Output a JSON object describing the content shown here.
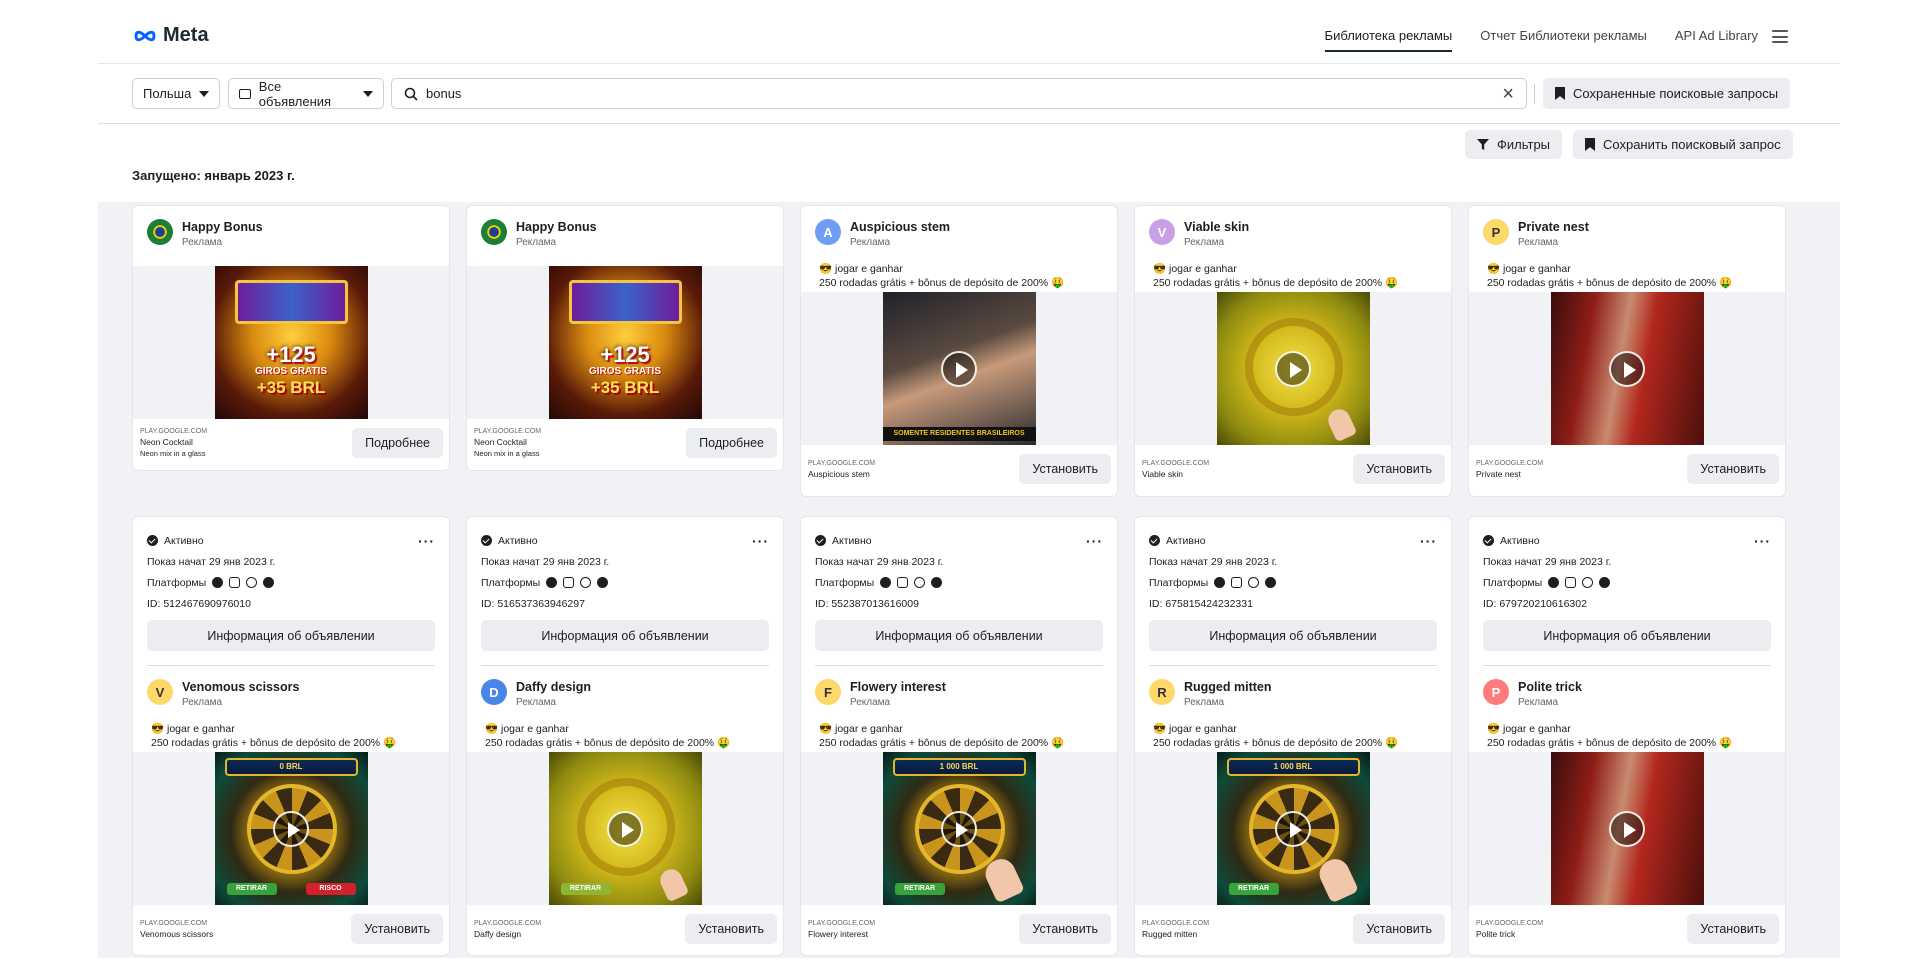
{
  "header": {
    "logo_text": "Meta",
    "nav": [
      "Библиотека рекламы",
      "Отчет Библиотеки рекламы",
      "API Ad Library"
    ]
  },
  "search": {
    "country": "Польша",
    "category": "Все объявления",
    "query": "bonus",
    "saved_searches_label": "Сохраненные поисковые запросы"
  },
  "toolbar": {
    "filters_label": "Фильтры",
    "save_search_label": "Сохранить поисковый запрос"
  },
  "launched_label": "Запущено: январь 2023 г.",
  "top_cards": [
    {
      "name": "Happy Bonus",
      "sub": "Реклама",
      "avatar_letter": "",
      "text1": "",
      "text2": "",
      "domain": "PLAY.GOOGLE.COM",
      "footer_name": "Neon Cocktail",
      "footer_desc": "Neon mix in a glass",
      "cta": "Подробнее",
      "creative": {
        "top": "",
        "big": "+125",
        "small": "GIROS GRATIS",
        "cash": "+35 BRL"
      }
    },
    {
      "name": "Happy Bonus",
      "sub": "Реклама",
      "avatar_letter": "",
      "text1": "",
      "text2": "",
      "domain": "PLAY.GOOGLE.COM",
      "footer_name": "Neon Cocktail",
      "footer_desc": "Neon mix in a glass",
      "cta": "Подробнее",
      "creative": {
        "top": "",
        "big": "+125",
        "small": "GIROS GRATIS",
        "cash": "+35 BRL"
      }
    },
    {
      "name": "Auspicious stem",
      "sub": "Реклама",
      "avatar_letter": "A",
      "text1": "😎 jogar e ganhar",
      "text2": "250 rodadas grátis + bônus de depósito de 200% 🤑",
      "domain": "PLAY.GOOGLE.COM",
      "footer_name": "Auspicious stem",
      "footer_desc": "",
      "cta": "Установить",
      "creative": {
        "top": "",
        "big": "",
        "small": "",
        "cash": "SOMENTE RESIDENTES BRASILEIROS"
      }
    },
    {
      "name": "Viable skin",
      "sub": "Реклама",
      "avatar_letter": "V",
      "text1": "😎 jogar e ganhar",
      "text2": "250 rodadas grátis + bônus de depósito de 200% 🤑",
      "domain": "PLAY.GOOGLE.COM",
      "footer_name": "Viable skin",
      "footer_desc": "",
      "cta": "Установить",
      "creative": {
        "top": "",
        "big": "",
        "small": "",
        "cash": ""
      }
    },
    {
      "name": "Private nest",
      "sub": "Реклама",
      "avatar_letter": "P",
      "text1": "😎 jogar e ganhar",
      "text2": "250 rodadas grátis + bônus de depósito de 200% 🤑",
      "domain": "PLAY.GOOGLE.COM",
      "footer_name": "Private nest",
      "footer_desc": "",
      "cta": "Установить",
      "creative": {
        "top": "",
        "big": "",
        "small": "",
        "cash": ""
      }
    }
  ],
  "bottom_cards": [
    {
      "status": "Активно",
      "started": "Показ начат 29 янв 2023 г.",
      "platforms_label": "Платформы",
      "id": "ID: 512467690976010",
      "info_btn": "Информация об объявлении",
      "name": "Venomous scissors",
      "sub": "Реклама",
      "avatar_letter": "V",
      "text1": "😎 jogar e ganhar",
      "text2": "250 rodadas grátis + bônus de depósito de 200% 🤑",
      "domain": "PLAY.GOOGLE.COM",
      "footer_name": "Venomous scissors",
      "cta": "Установить",
      "creative": {
        "top": "0 BRL",
        "btn1": "RETIRAR",
        "btn2": "RISCO"
      }
    },
    {
      "status": "Активно",
      "started": "Показ начат 29 янв 2023 г.",
      "platforms_label": "Платформы",
      "id": "ID: 516537363946297",
      "info_btn": "Информация об объявлении",
      "name": "Daffy design",
      "sub": "Реклама",
      "avatar_letter": "D",
      "text1": "😎 jogar e ganhar",
      "text2": "250 rodadas grátis + bônus de depósito de 200% 🤑",
      "domain": "PLAY.GOOGLE.COM",
      "footer_name": "Daffy design",
      "cta": "Установить",
      "creative": {
        "top": "",
        "btn1": "RETIRAR",
        "btn2": ""
      }
    },
    {
      "status": "Активно",
      "started": "Показ начат 29 янв 2023 г.",
      "platforms_label": "Платформы",
      "id": "ID: 552387013616009",
      "info_btn": "Информация об объявлении",
      "name": "Flowery interest",
      "sub": "Реклама",
      "avatar_letter": "F",
      "text1": "😎 jogar e ganhar",
      "text2": "250 rodadas grátis + bônus de depósito de 200% 🤑",
      "domain": "PLAY.GOOGLE.COM",
      "footer_name": "Flowery interest",
      "cta": "Установить",
      "creative": {
        "top": "1 000 BRL",
        "btn1": "RETIRAR",
        "btn2": ""
      }
    },
    {
      "status": "Активно",
      "started": "Показ начат 29 янв 2023 г.",
      "platforms_label": "Платформы",
      "id": "ID: 675815424232331",
      "info_btn": "Информация об объявлении",
      "name": "Rugged mitten",
      "sub": "Реклама",
      "avatar_letter": "R",
      "text1": "😎 jogar e ganhar",
      "text2": "250 rodadas grátis + bônus de depósito de 200% 🤑",
      "domain": "PLAY.GOOGLE.COM",
      "footer_name": "Rugged mitten",
      "cta": "Установить",
      "creative": {
        "top": "1 000 BRL",
        "btn1": "RETIRAR",
        "btn2": ""
      }
    },
    {
      "status": "Активно",
      "started": "Показ начат 29 янв 2023 г.",
      "platforms_label": "Платформы",
      "id": "ID: 679720210616302",
      "info_btn": "Информация об объявлении",
      "name": "Polite trick",
      "sub": "Реклама",
      "avatar_letter": "P",
      "text1": "😎 jogar e ganhar",
      "text2": "250 rodadas grátis + bônus de depósito de 200% 🤑",
      "domain": "PLAY.GOOGLE.COM",
      "footer_name": "Polite trick",
      "cta": "Установить",
      "creative": {
        "top": "",
        "btn1": "",
        "btn2": ""
      }
    }
  ],
  "colors": {
    "avatar_a": "#6f9df2",
    "avatar_v": "#c9a0e8",
    "avatar_p": "#ffd86b",
    "avatar_v2": "#ffd86b",
    "avatar_d": "#4a86e8",
    "avatar_f": "#ffd86b",
    "avatar_r": "#ffd86b",
    "avatar_p2": "#ff7b7b"
  }
}
